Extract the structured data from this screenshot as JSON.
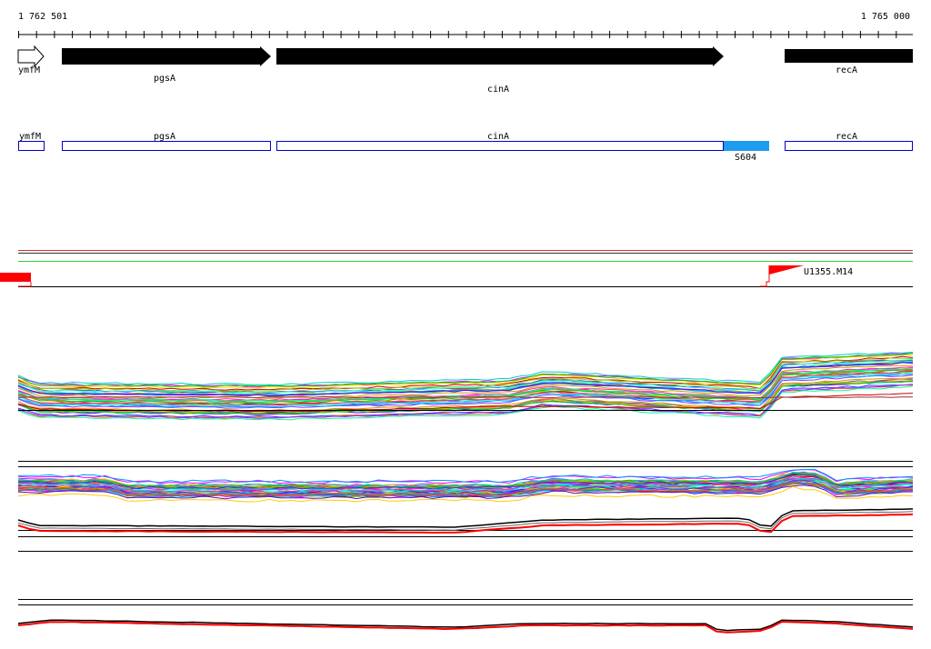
{
  "ruler": {
    "start_label": "1 762 501",
    "end_label": "1 765 000"
  },
  "genes": [
    {
      "name": "ymfM",
      "style": "open-arrow"
    },
    {
      "name": "pgsA",
      "style": "filled-arrow"
    },
    {
      "name": "cinA",
      "style": "filled-arrow"
    },
    {
      "name": "recA",
      "style": "filled-bar"
    }
  ],
  "transcripts": [
    {
      "name": "ymfM"
    },
    {
      "name": "pgsA"
    },
    {
      "name": "cinA"
    },
    {
      "name": "recA"
    }
  ],
  "segment": {
    "name": "S604",
    "color": "#1f9bf0"
  },
  "upshift": {
    "name": "U1355.M14",
    "color": "#ff0000"
  },
  "colors": {
    "gene_fill": "#000000",
    "transcript_stroke": "#0000cc",
    "highlight_red": "#ff0000",
    "track_green": "#33cc33"
  }
}
